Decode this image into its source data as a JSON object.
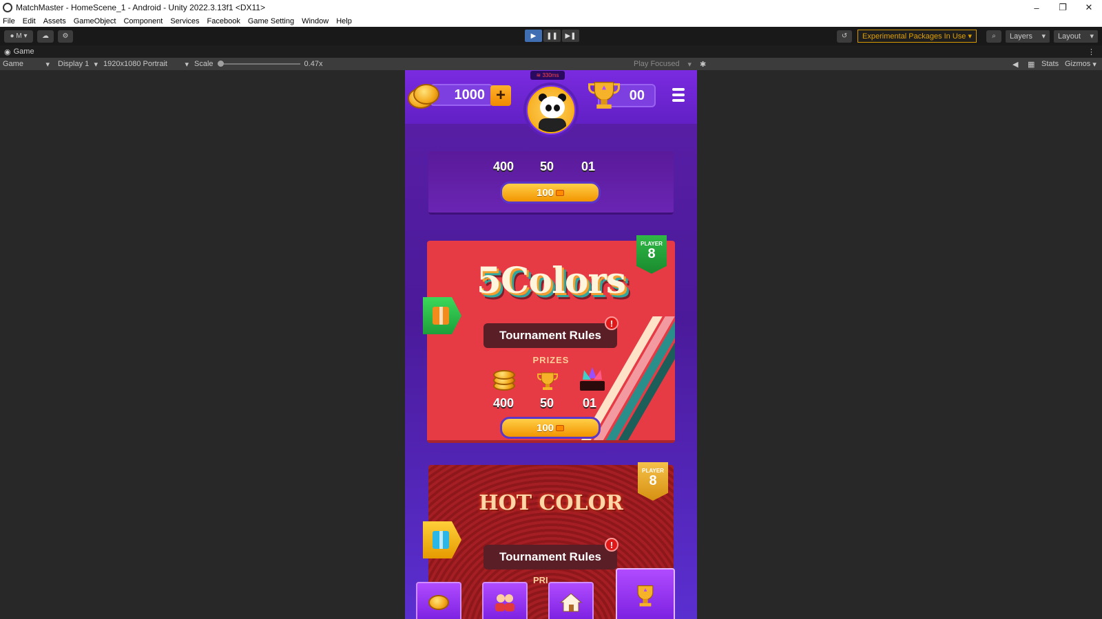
{
  "window": {
    "title": "MatchMaster - HomeScene_1 - Android - Unity 2022.3.13f1 <DX11>",
    "controls": [
      "–",
      "❐",
      "✕"
    ]
  },
  "menu": [
    "File",
    "Edit",
    "Assets",
    "GameObject",
    "Component",
    "Services",
    "Facebook",
    "Game Setting",
    "Window",
    "Help"
  ],
  "toolbar": {
    "account_label": "M",
    "experimental_label": "Experimental Packages In Use ▾",
    "layers_label": "Layers",
    "layout_label": "Layout"
  },
  "game_tab": {
    "tab_label": "Game",
    "view_select": "Game",
    "display_select": "Display 1",
    "resolution_select": "1920x1080 Portrait",
    "scale_label": "Scale",
    "scale_value": "0.47x",
    "play_mode": "Play Focused",
    "stats_label": "Stats",
    "gizmos_label": "Gizmos"
  },
  "game": {
    "ping": "330ms",
    "coins": "1000",
    "plus": "+",
    "trophies": "00",
    "card1": {
      "prize_coins": "400",
      "prize_trophies": "50",
      "prize_items": "01",
      "entry_cost": "100"
    },
    "card2": {
      "title": "5Colors",
      "players_label": "PLAYER",
      "players": "8",
      "rules_label": "Tournament Rules",
      "alert": "!",
      "prizes_label": "PRIZES",
      "prize_coins": "400",
      "prize_trophies": "50",
      "prize_items": "01",
      "entry_cost": "100"
    },
    "card3": {
      "title": "HOT COLOR",
      "players_label": "PLAYER",
      "players": "8",
      "rules_label": "Tournament Rules",
      "alert": "!",
      "prizes_label_partial": "PRI"
    }
  },
  "colors": {
    "editor_bg": "#282828",
    "toolbar_bg": "#191919",
    "accent_play": "#3f6eb3",
    "warning": "#d79b00",
    "game_purple": "#5b1fa8",
    "card_red": "#e63b45",
    "coin_gold": "#f3a71a"
  },
  "icons": [
    "unity-logo-icon",
    "account-icon",
    "cloud-icon",
    "settings-icon",
    "play-icon",
    "pause-icon",
    "step-icon",
    "history-icon",
    "search-icon",
    "coin-icon",
    "plus-icon",
    "panda-avatar-icon",
    "trophy-icon",
    "hamburger-menu-icon",
    "gift-icon",
    "ticket-icon",
    "home-icon",
    "friends-icon",
    "shop-coins-icon"
  ]
}
